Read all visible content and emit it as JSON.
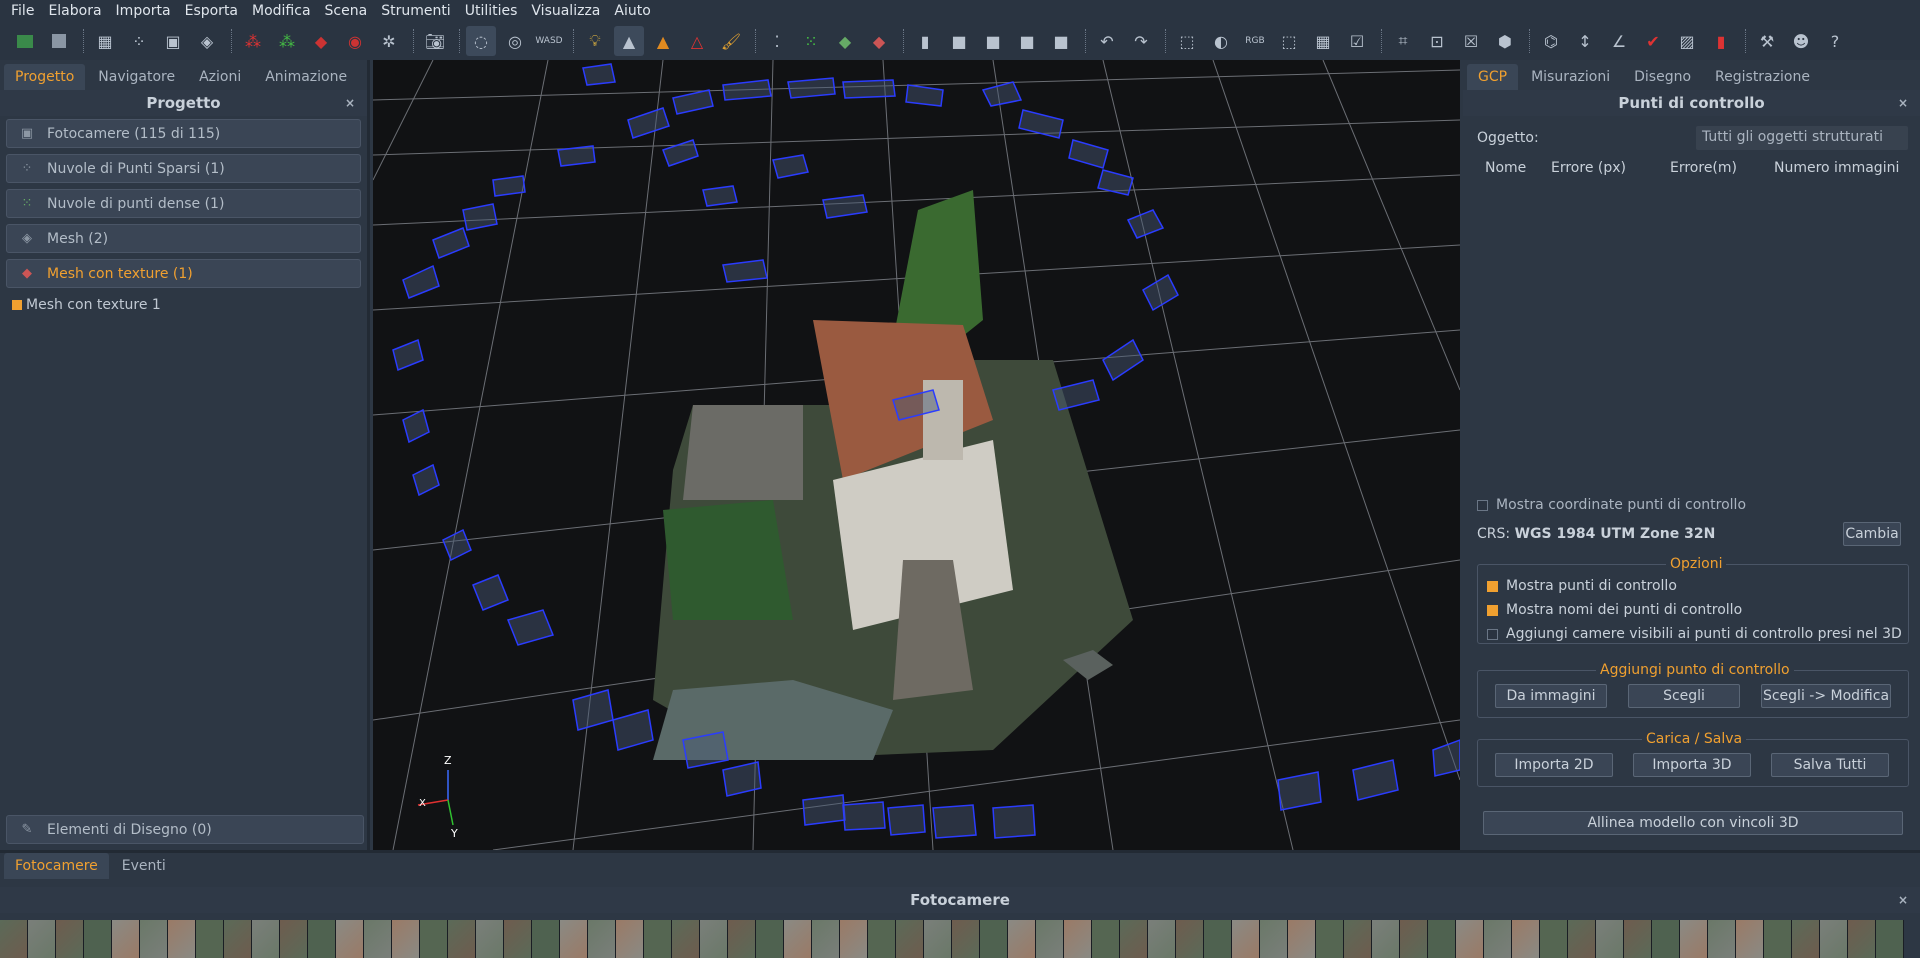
{
  "menu": [
    "File",
    "Elabora",
    "Importa",
    "Esporta",
    "Modifica",
    "Scena",
    "Strumenti",
    "Utilities",
    "Visualizza",
    "Aiuto"
  ],
  "left": {
    "tabs": [
      "Progetto",
      "Navigatore",
      "Azioni",
      "Animazione"
    ],
    "title": "Progetto",
    "close": "×",
    "items": [
      {
        "label": "Fotocamere (115 di 115)",
        "icon": "camera-icon"
      },
      {
        "label": "Nuvole di Punti Sparsi (1)",
        "icon": "sparse-cloud-icon"
      },
      {
        "label": "Nuvole di punti dense (1)",
        "icon": "dense-cloud-icon"
      },
      {
        "label": "Mesh (2)",
        "icon": "mesh-icon"
      },
      {
        "label": "Mesh con texture (1)",
        "icon": "textured-mesh-icon"
      }
    ],
    "sub_item": "Mesh con texture 1",
    "drawing": "Elementi di Disegno (0)"
  },
  "viewport": {
    "axis_z": "Z",
    "axis_x": "X",
    "axis_y": "Y"
  },
  "right": {
    "tabs": [
      "GCP",
      "Misurazioni",
      "Disegno",
      "Registrazione"
    ],
    "title": "Punti di controllo",
    "close": "×",
    "object_label": "Oggetto:",
    "object_value": "Tutti gli oggetti strutturati",
    "columns": [
      "Nome",
      "Errore (px)",
      "Errore(m)",
      "Numero immagini"
    ],
    "show_coords": "Mostra coordinate punti di controllo",
    "crs_label": "CRS:",
    "crs_value": "WGS 1984 UTM Zone 32N",
    "change": "Cambia",
    "options_title": "Opzioni",
    "options": [
      "Mostra punti di controllo",
      "Mostra nomi dei punti di controllo",
      "Aggiungi camere visibili ai punti di controllo presi nel 3D"
    ],
    "add_title": "Aggiungi punto di controllo",
    "add_buttons": [
      "Da immagini",
      "Scegli",
      "Scegli -> Modifica"
    ],
    "load_title": "Carica / Salva",
    "load_buttons": [
      "Importa 2D",
      "Importa 3D",
      "Salva Tutti"
    ],
    "align": "Allinea modello con vincoli 3D"
  },
  "bottom": {
    "tabs": [
      "Fotocamere",
      "Eventi"
    ],
    "title": "Fotocamere",
    "close": "×"
  },
  "colors": {
    "accent": "#f0a030",
    "panel": "#2d3744",
    "viewport": "#111214",
    "camera_frame": "#2a3cff"
  }
}
